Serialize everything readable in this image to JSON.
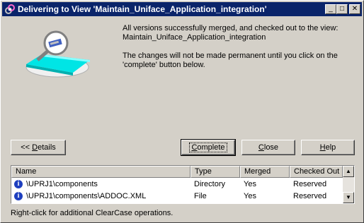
{
  "window": {
    "title": "Delivering to View 'Maintain_Uniface_Application_integration'",
    "controls": {
      "minimize": "_",
      "maximize": "□",
      "close": "✕"
    }
  },
  "message": {
    "line1": "All versions successfully merged, and checked out to the view:",
    "line2": "Maintain_Uniface_Application_integration",
    "line3": "The changes will not be made permanent until you click on the",
    "line4": "'complete' button below."
  },
  "buttons": {
    "details_prefix": "<< ",
    "details_key": "D",
    "details_rest": "etails",
    "complete_key": "C",
    "complete_rest": "omplete",
    "close_key": "C",
    "close_rest": "lose",
    "help_key": "H",
    "help_rest": "elp"
  },
  "table": {
    "columns": [
      "Name",
      "Type",
      "Merged",
      "Checked Out"
    ],
    "rows": [
      {
        "icon": "info-icon",
        "name": "\\UPRJ1\\components",
        "type": "Directory",
        "merged": "Yes",
        "checked_out": "Reserved"
      },
      {
        "icon": "info-icon",
        "name": "\\UPRJ1\\components\\ADDOC.XML",
        "type": "File",
        "merged": "Yes",
        "checked_out": "Reserved"
      }
    ],
    "scroll_up": "▲",
    "scroll_down": "▼"
  },
  "status": "Right-click for additional ClearCase operations.",
  "icons": {
    "app": "clearcase-app-icon",
    "illustration": "merge-magnifier-icon",
    "row": "info-icon"
  },
  "colors": {
    "titlebar": "#0a246a",
    "face": "#d4d0c8",
    "accent_cyan": "#00e5e5"
  }
}
